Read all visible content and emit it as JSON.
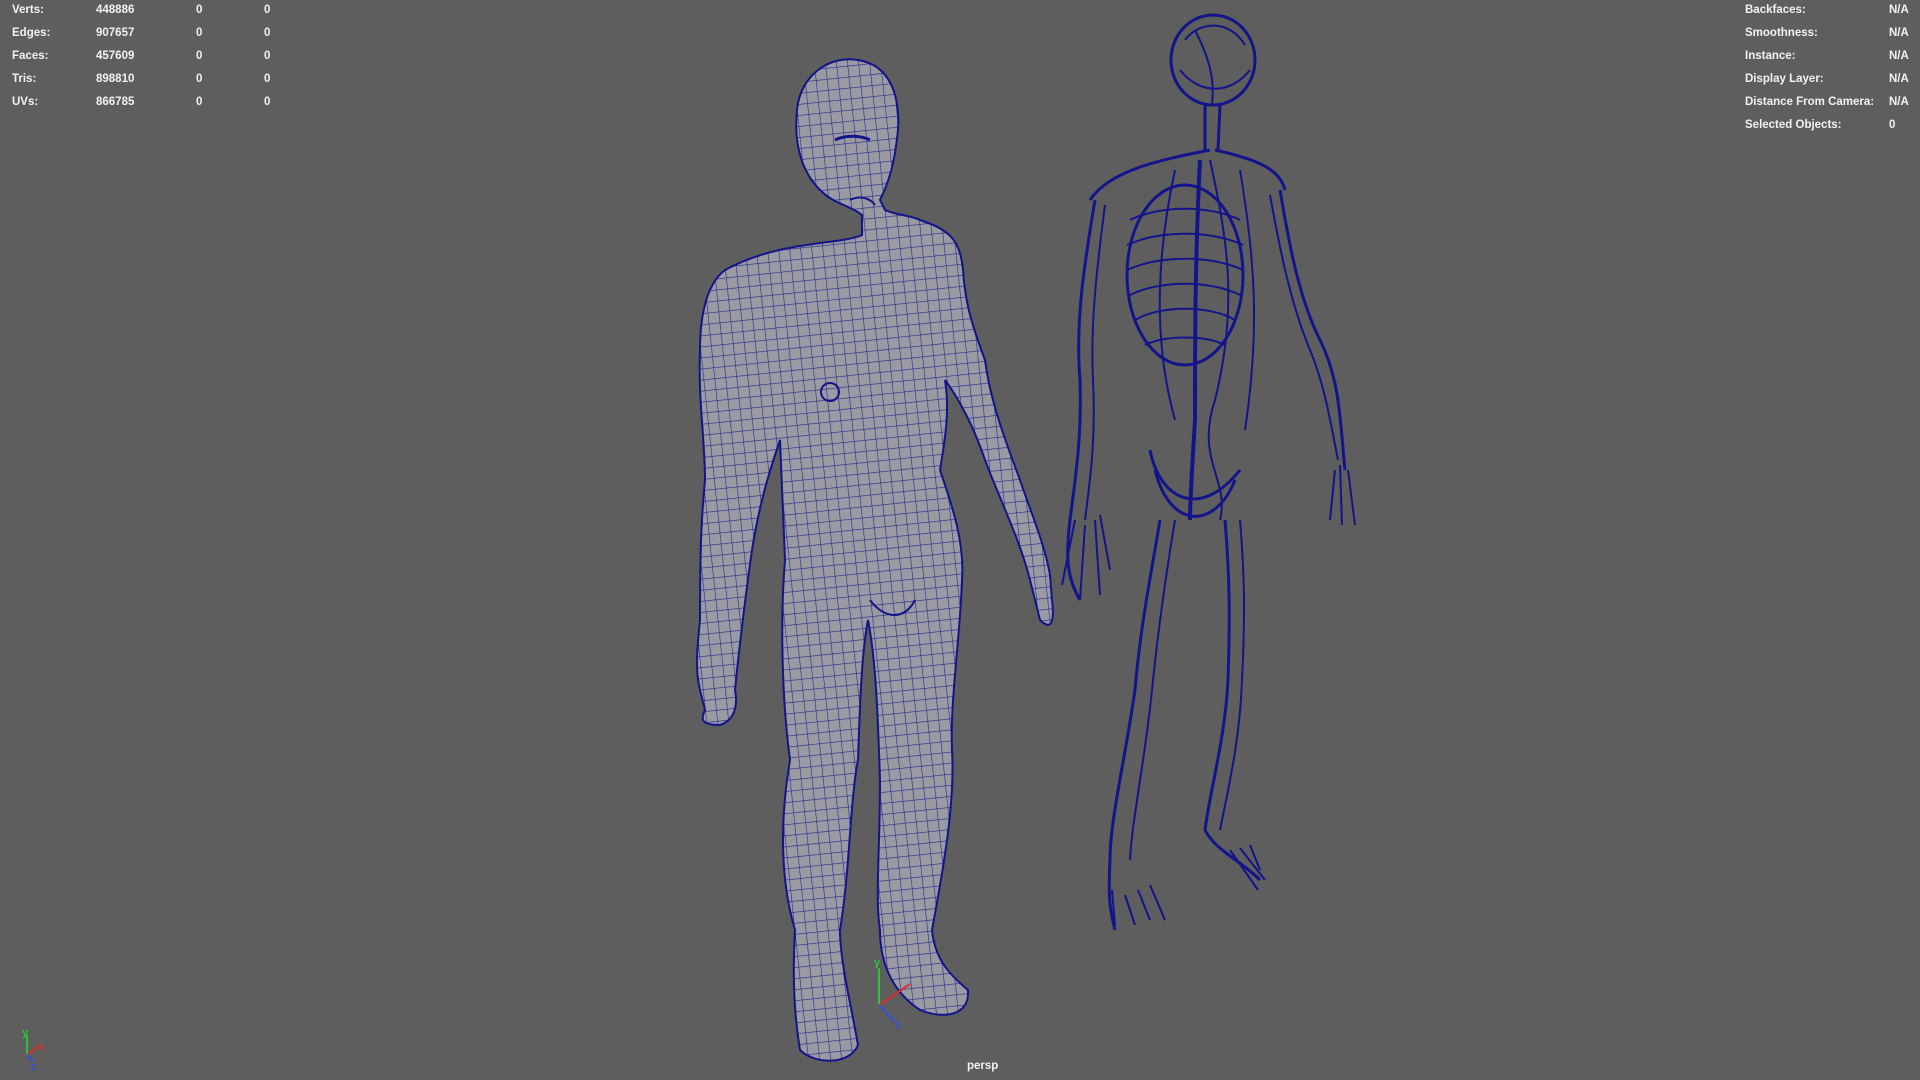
{
  "hud_left": {
    "rows": [
      {
        "label": "Verts:",
        "v0": "448886",
        "v1": "0",
        "v2": "0"
      },
      {
        "label": "Edges:",
        "v0": "907657",
        "v1": "0",
        "v2": "0"
      },
      {
        "label": "Faces:",
        "v0": "457609",
        "v1": "0",
        "v2": "0"
      },
      {
        "label": "Tris:",
        "v0": "898810",
        "v1": "0",
        "v2": "0"
      },
      {
        "label": "UVs:",
        "v0": "866785",
        "v1": "0",
        "v2": "0"
      }
    ]
  },
  "hud_right": {
    "rows": [
      {
        "label": "Backfaces:",
        "value": "N/A"
      },
      {
        "label": "Smoothness:",
        "value": "N/A"
      },
      {
        "label": "Instance:",
        "value": "N/A"
      },
      {
        "label": "Display Layer:",
        "value": "N/A"
      },
      {
        "label": "Distance From Camera:",
        "value": "N/A"
      },
      {
        "label": "Selected Objects:",
        "value": "0"
      }
    ]
  },
  "viewport": {
    "camera": "persp",
    "background_color": "#5e5e5e",
    "wire_color": "#14148a",
    "shaded_color": "#9a9aa2"
  },
  "axis": {
    "x": "x",
    "y": "y",
    "z": "z",
    "x_color": "#d43030",
    "y_color": "#30c040",
    "z_color": "#3050e0"
  }
}
